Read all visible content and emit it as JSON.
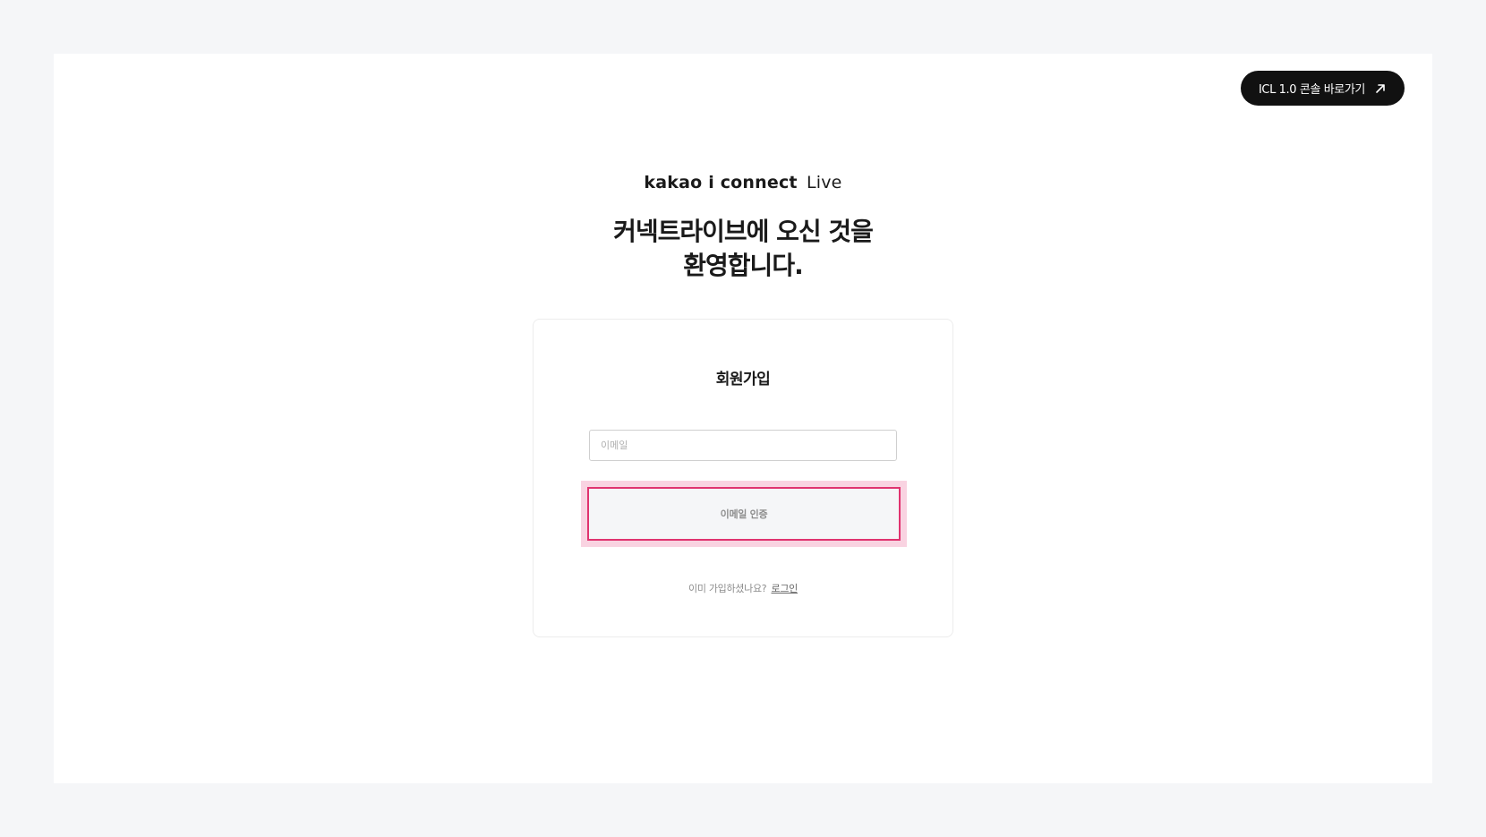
{
  "header": {
    "console_link_label": "ICL 1.0 콘솔 바로가기",
    "console_link_icon": "external-arrow-icon"
  },
  "brand": {
    "name": "kakao i connect",
    "suffix": "Live"
  },
  "headline": {
    "line1": "커넥트라이브에 오신 것을",
    "line2": "환영합니다."
  },
  "signup": {
    "title": "회원가입",
    "email_placeholder": "이메일",
    "email_value": "",
    "verify_button_label": "이메일 인증",
    "already_member_text": "이미 가입하셨나요?",
    "login_link_label": "로그인"
  },
  "colors": {
    "background": "#f5f6f8",
    "accent_highlight": "#e0336f",
    "highlight_fill": "#f9d3e1",
    "console_button": "#111111"
  }
}
